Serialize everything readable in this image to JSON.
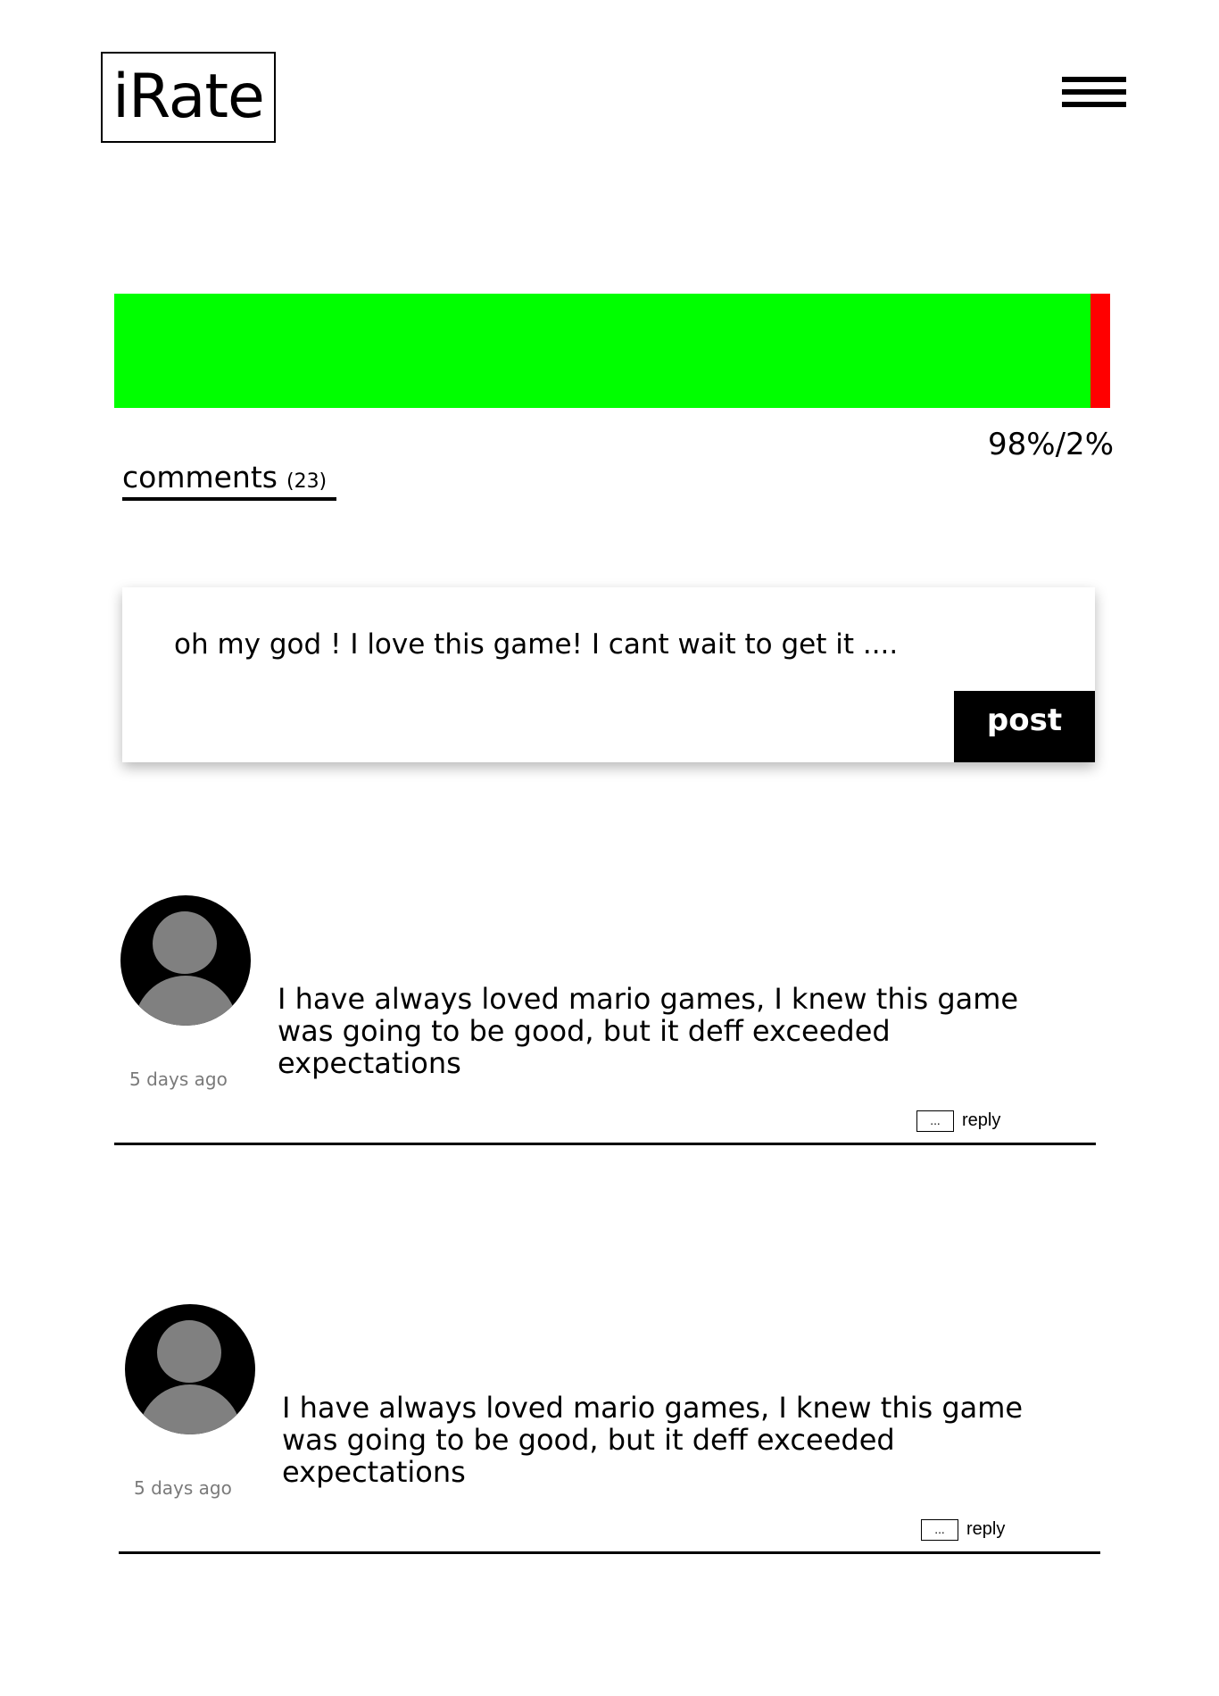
{
  "header": {
    "logo": "iRate",
    "menu_icon": "hamburger-menu-icon"
  },
  "rating": {
    "positive_percent": 98,
    "negative_percent": 2,
    "positive_color": "#00ff00",
    "negative_color": "#ff0000",
    "label": "98%/2%"
  },
  "comments_tab": {
    "label": "comments",
    "count": "(23)"
  },
  "composer": {
    "value": "oh my god ! I love this game! I cant wait to get it ....",
    "post_label": "post"
  },
  "comments": [
    {
      "text": "I have always loved mario games, I knew this game was going to be good, but it deff exceeded expectations",
      "time": "5 days ago",
      "more_label": "...",
      "reply_label": "reply"
    },
    {
      "text": "I have always loved mario games, I knew this game was going to be good, but it deff exceeded expectations",
      "time": "5 days ago",
      "more_label": "...",
      "reply_label": "reply"
    }
  ]
}
